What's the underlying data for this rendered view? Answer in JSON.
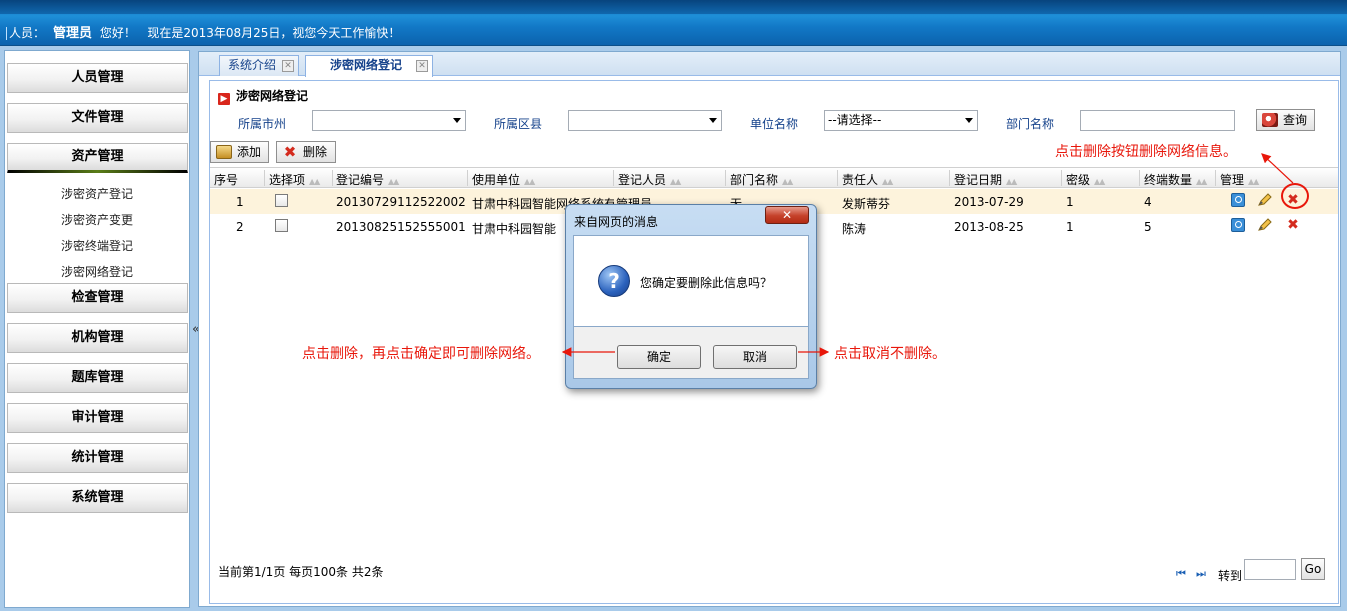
{
  "header": {
    "user_label": "人员：",
    "user_name": "管理员",
    "greeting": "您好！",
    "date_text": "现在是2013年08月25日，视您今天工作愉快！"
  },
  "sidebar": {
    "menus": [
      "人员管理",
      "文件管理",
      "资产管理",
      "检查管理",
      "机构管理",
      "题库管理",
      "审计管理",
      "统计管理",
      "系统管理"
    ],
    "active_menu": "资产管理",
    "sub_items": [
      "涉密资产登记",
      "涉密资产变更",
      "涉密终端登记",
      "涉密网络登记"
    ],
    "collapse_glyph": "«"
  },
  "tabs": [
    {
      "label": "系统介绍"
    },
    {
      "label": "涉密网络登记"
    }
  ],
  "section_title": "涉密网络登记",
  "filters": {
    "city_label": "所属市州",
    "district_label": "所属区县",
    "unit_label": "单位名称",
    "unit_value": "--请选择--",
    "dept_label": "部门名称",
    "query_button": "查询"
  },
  "toolbar": {
    "add_label": "添加",
    "delete_label": "删除"
  },
  "table": {
    "columns": [
      "序号",
      "选择项",
      "登记编号",
      "使用单位",
      "登记人员",
      "部门名称",
      "责任人",
      "登记日期",
      "密级",
      "终端数量",
      "管理"
    ],
    "rows": [
      {
        "no": "1",
        "reg_no": "20130729112522002",
        "unit": "甘肃中科园智能网络系统有",
        "registrant": "管理员",
        "dept": "无",
        "owner": "发斯蒂芬",
        "date": "2013-07-29",
        "level": "1",
        "terminals": "4"
      },
      {
        "no": "2",
        "reg_no": "20130825152555001",
        "unit": "甘肃中科园智能",
        "registrant": "",
        "dept": "",
        "owner": "陈涛",
        "date": "2013-08-25",
        "level": "1",
        "terminals": "5"
      }
    ]
  },
  "pager": {
    "status": "当前第1/1页  每页100条  共2条",
    "goto_label": "转到",
    "go_button": "Go"
  },
  "dialog": {
    "title": "来自网页的消息",
    "message": "您确定要删除此信息吗？",
    "ok": "确定",
    "cancel": "取消",
    "icon": "question-icon"
  },
  "annotations": {
    "delete_hint": "点击删除按钮删除网络信息。",
    "ok_hint": "点击删除，再点击确定即可删除网络。",
    "cancel_hint": "点击取消不删除。",
    "color": "#e8170b"
  }
}
